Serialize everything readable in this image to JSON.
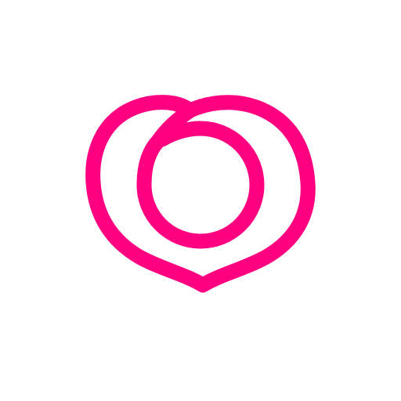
{
  "app_icon": {
    "icon_name": "peach-heart-logo-icon",
    "colors": {
      "stroke": "#FF0080",
      "background": "#FFFFFF"
    }
  }
}
